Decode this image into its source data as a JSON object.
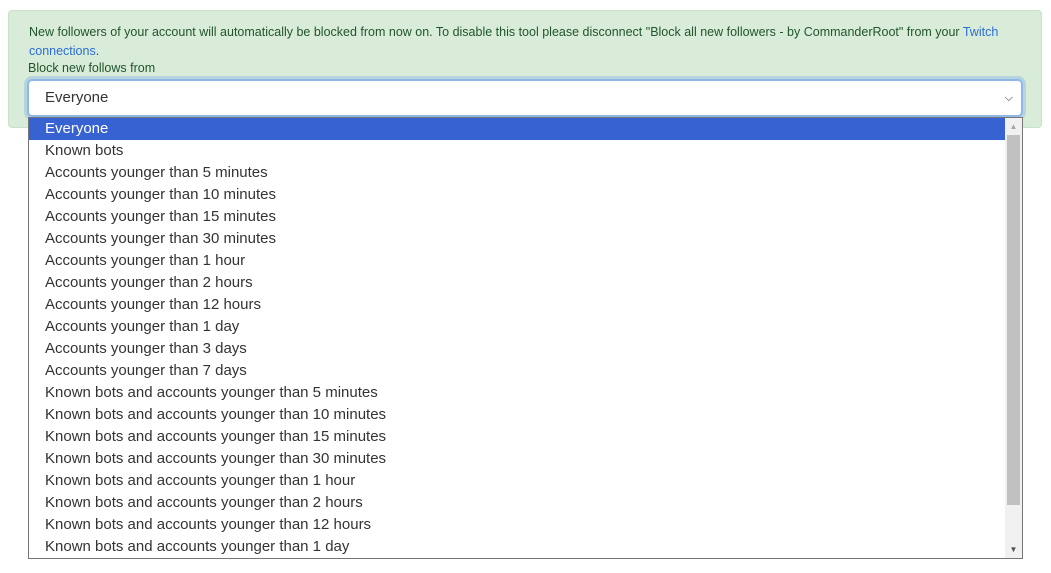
{
  "alert": {
    "text": "New followers of your account will automatically be blocked from now on. To disable this tool please disconnect \"Block all new followers - by CommanderRoot\" from your ",
    "link_text": "Twitch connections",
    "text_end": "."
  },
  "field": {
    "label": "Block new follows from",
    "selected_value": "Everyone",
    "chevron_icon": "chevron-down-icon"
  },
  "dropdown": {
    "options": [
      "Everyone",
      "Known bots",
      "Accounts younger than 5 minutes",
      "Accounts younger than 10 minutes",
      "Accounts younger than 15 minutes",
      "Accounts younger than 30 minutes",
      "Accounts younger than 1 hour",
      "Accounts younger than 2 hours",
      "Accounts younger than 12 hours",
      "Accounts younger than 1 day",
      "Accounts younger than 3 days",
      "Accounts younger than 7 days",
      "Known bots and accounts younger than 5 minutes",
      "Known bots and accounts younger than 10 minutes",
      "Known bots and accounts younger than 15 minutes",
      "Known bots and accounts younger than 30 minutes",
      "Known bots and accounts younger than 1 hour",
      "Known bots and accounts younger than 2 hours",
      "Known bots and accounts younger than 12 hours",
      "Known bots and accounts younger than 1 day"
    ],
    "selected_index": 0
  },
  "colors": {
    "alert_bg": "#d8ecd9",
    "link": "#2b6dd6",
    "selected_option_bg": "#3763d2"
  }
}
